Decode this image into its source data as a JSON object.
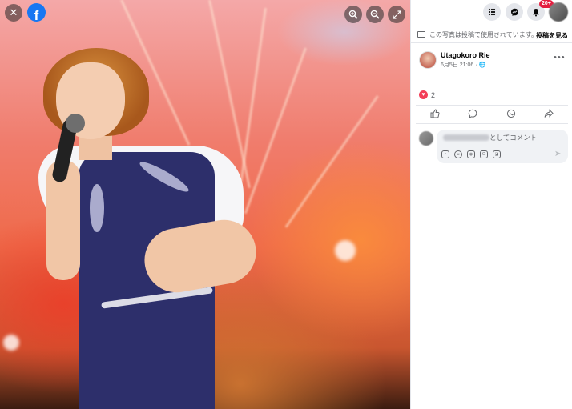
{
  "viewer": {
    "close_icon": "close-icon",
    "logo_letter": "f",
    "controls": {
      "zoom_in_icon": "zoom-in-icon",
      "zoom_out_icon": "zoom-out-icon",
      "fullscreen_icon": "fullscreen-icon"
    }
  },
  "topbar": {
    "menu_icon": "grid-menu-icon",
    "messenger_icon": "messenger-icon",
    "notifications_icon": "bell-icon",
    "notification_count": "20+"
  },
  "usage": {
    "text": "この写真は投稿で使用されています。",
    "link": "投稿を見る"
  },
  "post": {
    "author": "Utagokoro Rie",
    "time": "6月5日 21:06 · ",
    "reaction_count": "2"
  },
  "comment": {
    "placeholder": "としてコメント"
  },
  "colors": {
    "brand": "#1877f2",
    "badge": "#e41e3f",
    "heart": "#f33e58"
  }
}
